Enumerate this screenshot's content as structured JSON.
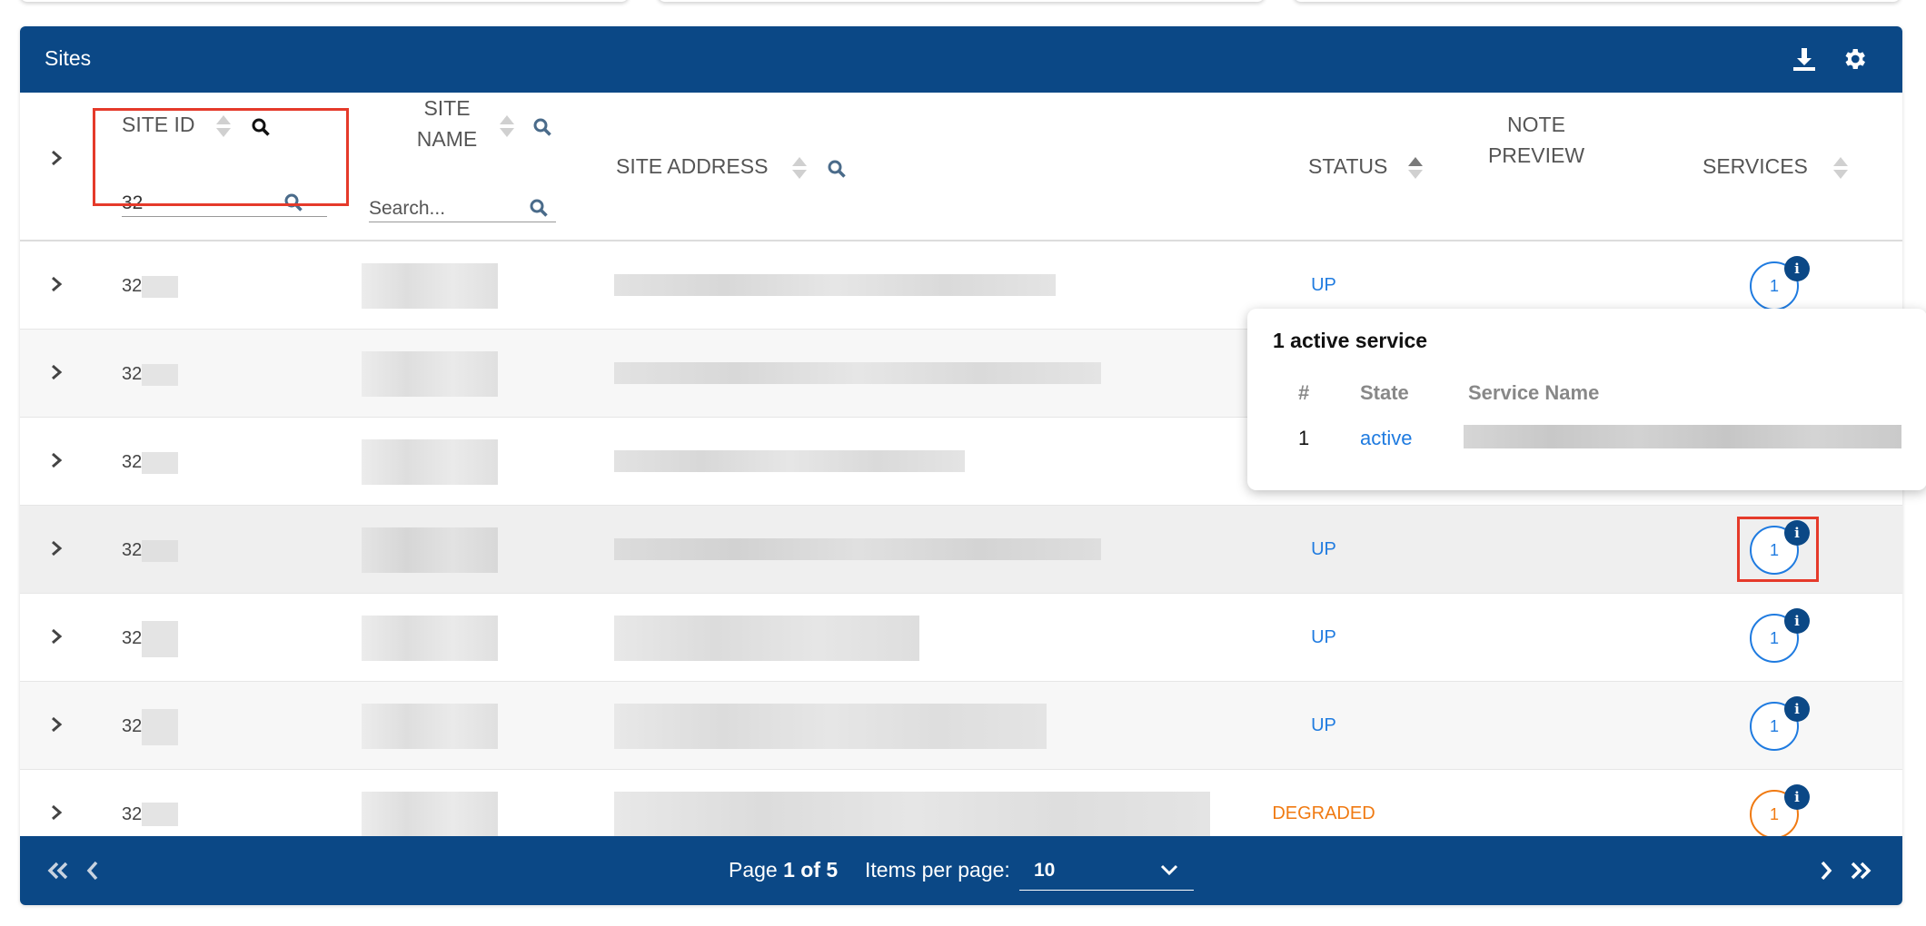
{
  "panel": {
    "title": "Sites"
  },
  "header_icons": {
    "download": "download-icon",
    "settings": "gear-icon"
  },
  "columns": {
    "site_id": "SITE ID",
    "site_name_line1": "SITE",
    "site_name_line2": "NAME",
    "site_address": "SITE ADDRESS",
    "status": "STATUS",
    "note_line1": "NOTE",
    "note_line2": "PREVIEW",
    "services": "SERVICES"
  },
  "filters": {
    "site_id_value": "32",
    "site_name_placeholder": "Search..."
  },
  "rows": [
    {
      "site_id": "32",
      "status": "UP",
      "status_type": "up",
      "services": "1"
    },
    {
      "site_id": "32",
      "status": "",
      "status_type": "up",
      "services": ""
    },
    {
      "site_id": "32",
      "status": "",
      "status_type": "up",
      "services": ""
    },
    {
      "site_id": "32",
      "status": "UP",
      "status_type": "up",
      "services": "1"
    },
    {
      "site_id": "32",
      "status": "UP",
      "status_type": "up",
      "services": "1"
    },
    {
      "site_id": "32",
      "status": "UP",
      "status_type": "up",
      "services": "1"
    },
    {
      "site_id": "32",
      "status": "DEGRADED",
      "status_type": "degraded",
      "services": "1"
    }
  ],
  "popover": {
    "title": "1 active service",
    "headers": {
      "num": "#",
      "state": "State",
      "service_name": "Service Name"
    },
    "row": {
      "num": "1",
      "state": "active"
    }
  },
  "pagination": {
    "page_prefix": "Page",
    "page_current": "1 of 5",
    "items_per_page_label": "Items per page:",
    "items_per_page_value": "10"
  },
  "colors": {
    "brand": "#0b4886",
    "status_up": "#1f7be0",
    "status_degraded": "#f07a12",
    "highlight": "#e53a2a"
  }
}
